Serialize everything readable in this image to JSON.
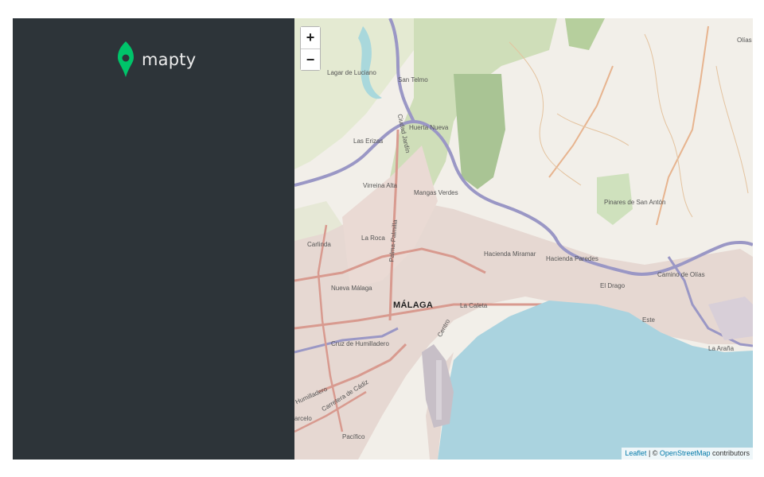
{
  "sidebar": {
    "logo_text": "mapty",
    "brand_color": "#00c46a",
    "background": "#2d3439"
  },
  "map": {
    "zoom_in_label": "+",
    "zoom_out_label": "−",
    "attribution": {
      "leaflet": "Leaflet",
      "separator": " | © ",
      "osm": "OpenStreetMap",
      "contributors": " contributors"
    },
    "city_label": "MÁLAGA",
    "place_labels": {
      "lagar": "Lagar de Luciano",
      "san_telmo": "San Telmo",
      "huerta": "Huerta Nueva",
      "erizas": "Las Erizas",
      "virreina": "Virreina Alta",
      "mangas": "Mangas Verdes",
      "pinares": "Pinares de San Antón",
      "camino": "Camino de Olías",
      "carlinda": "Carlinda",
      "la_roca": "La Roca",
      "nueva_malaga": "Nueva Málaga",
      "h_miramar": "Hacienda Miramar",
      "h_paredes": "Hacienda Paredes",
      "el_drago": "El Drago",
      "la_caleta": "La Caleta",
      "cruz": "Cruz de Humilladero",
      "centro": "Centro",
      "este": "Este",
      "la_araña": "La Araña",
      "olias": "Olías",
      "ciudad_jardin": "Ciudad Jardín",
      "palma": "Palma-Palmilla",
      "carretera": "Carretera de Cádiz",
      "humilladero": "Humilladero",
      "carcelo": "arcelo",
      "pacifico": "Pacífico",
      "este_road": "Este"
    }
  }
}
